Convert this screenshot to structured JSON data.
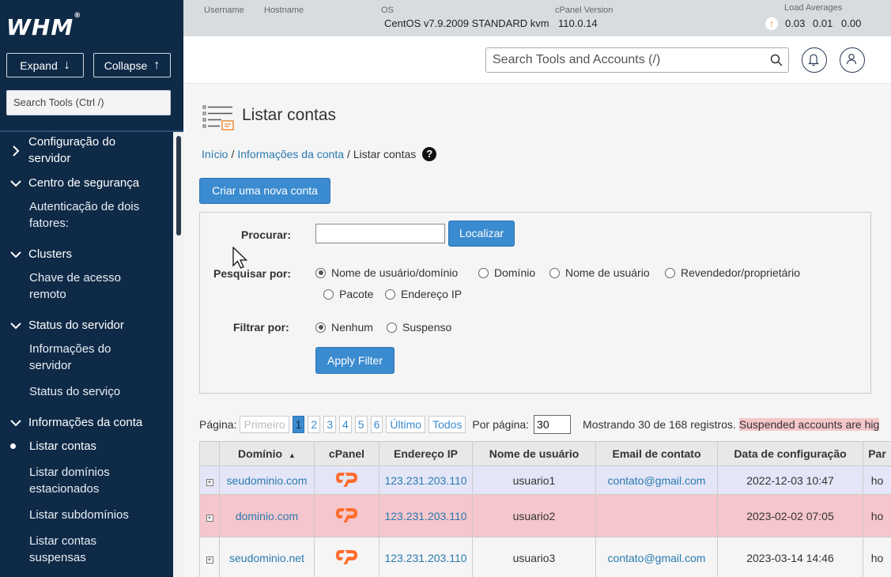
{
  "sidebar": {
    "logo": "WHM",
    "logo_mark": "®",
    "expand_label": "Expand",
    "collapse_label": "Collapse",
    "search_placeholder": "Search Tools (Ctrl /)",
    "sections": [
      {
        "label_line1": "Configuração do",
        "label_line2": "servidor",
        "expanded": false
      },
      {
        "label": "Centro de segurança",
        "expanded": true
      },
      {
        "label": "Clusters",
        "expanded": true
      },
      {
        "label": "Status do servidor",
        "expanded": true
      },
      {
        "label": "Informações da conta",
        "expanded": true
      }
    ],
    "items": {
      "auth_line1": "Autenticação de dois",
      "auth_line2": "fatores:",
      "remote_line1": "Chave de acesso",
      "remote_line2": "remoto",
      "info_line1": "Informações do",
      "info_line2": "servidor",
      "service_status": "Status do serviço",
      "list_accounts": "Listar contas",
      "parked_line1": "Listar domínios",
      "parked_line2": "estacionados",
      "subdomains": "Listar subdomínios",
      "suspended_line1": "Listar contas",
      "suspended_line2": "suspensas"
    }
  },
  "topbar": {
    "username_label": "Username",
    "hostname_label": "Hostname",
    "os_label": "OS",
    "os_value": "CentOS v7.9.2009 STANDARD kvm",
    "cpanel_label": "cPanel Version",
    "cpanel_value": "110.0.14",
    "load_label": "Load Averages",
    "load_1": "0.03",
    "load_5": "0.01",
    "load_15": "0.00"
  },
  "header": {
    "search_placeholder": "Search Tools and Accounts (/)"
  },
  "page": {
    "title": "Listar contas",
    "breadcrumb": {
      "home": "Início",
      "parent": "Informações da conta",
      "current": "Listar contas",
      "sep": "/"
    },
    "help": "?",
    "create_button": "Criar uma nova conta"
  },
  "filter": {
    "search_label": "Procurar:",
    "search_value": "",
    "find_button": "Localizar",
    "search_by_label": "Pesquisar por:",
    "search_by_options": [
      "Nome de usuário/domínio",
      "Domínio",
      "Nome de usuário",
      "Revendedor/proprietário",
      "Pacote",
      "Endereço IP"
    ],
    "search_by_selected": 0,
    "filter_by_label": "Filtrar por:",
    "filter_by_options": [
      "Nenhum",
      "Suspenso"
    ],
    "filter_by_selected": 0,
    "apply_button": "Apply Filter"
  },
  "pagination": {
    "label": "Página:",
    "first": "Primeiro",
    "pages": [
      "1",
      "2",
      "3",
      "4",
      "5",
      "6"
    ],
    "current_page": "1",
    "last": "Último",
    "all": "Todos",
    "per_page_label": "Por página:",
    "per_page_value": "30",
    "showing": "Mostrando 30 de 168 registros.",
    "suspended_note": "Suspended accounts are hig"
  },
  "table": {
    "headers": [
      "",
      "Domínio",
      "cPanel",
      "Endereço IP",
      "Nome de usuário",
      "Email de contato",
      "Data de configuração",
      "Par"
    ],
    "rows": [
      {
        "expand": "+",
        "domain": "seudominio.com",
        "ip": "123.231.203.110",
        "user": "usuario1",
        "email": "contato@gmail.com",
        "date": "2022-12-03 10:47",
        "partial": "ho"
      },
      {
        "expand": "+",
        "domain": "dominio.com",
        "ip": "123.231.203.110",
        "user": "usuario2",
        "email": "",
        "date": "2023-02-02 07:05",
        "partial": "ho"
      },
      {
        "expand": "+",
        "domain": "seudominio.net",
        "ip": "123.231.203.110",
        "user": "usuario3",
        "email": "contato@gmail.com",
        "date": "2023-03-14 14:46",
        "partial": "ho"
      }
    ]
  },
  "colors": {
    "sidebar_bg": "#0f2a47",
    "accent_blue": "#3b8bd0",
    "link": "#2a7ab0",
    "suspended_row": "#f5c6cb",
    "cpanel_orange": "#ff6c2c"
  }
}
